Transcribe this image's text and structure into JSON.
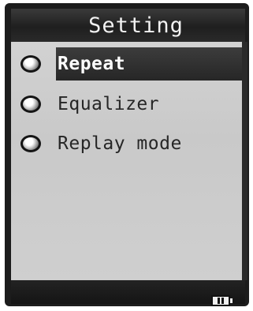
{
  "header": {
    "title": "Setting"
  },
  "menu": {
    "items": [
      {
        "label": "Repeat",
        "selected": true,
        "icon": "radio-bullet-icon"
      },
      {
        "label": "Equalizer",
        "selected": false,
        "icon": "radio-bullet-icon"
      },
      {
        "label": "Replay mode",
        "selected": false,
        "icon": "radio-bullet-icon"
      }
    ]
  },
  "status": {
    "battery_icon": "battery-icon"
  }
}
